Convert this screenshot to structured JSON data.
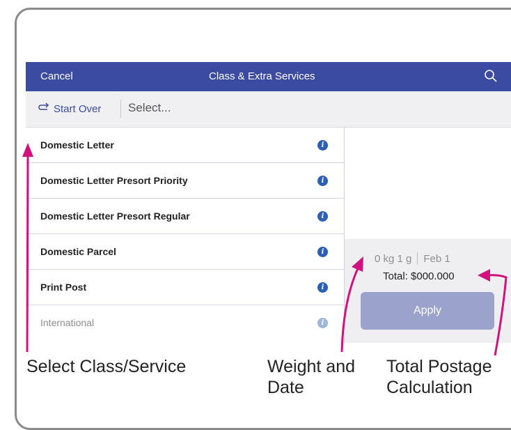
{
  "header": {
    "cancel_label": "Cancel",
    "title": "Class & Extra Services",
    "search_icon": "search-icon"
  },
  "subbar": {
    "start_over_label": "Start Over",
    "start_over_icon": "redo-arrow-icon",
    "select_placeholder": "Select..."
  },
  "services": [
    {
      "label": "Domestic Letter",
      "info_icon": "i"
    },
    {
      "label": "Domestic Letter Presort Priority",
      "info_icon": "i"
    },
    {
      "label": "Domestic Letter Presort Regular",
      "info_icon": "i"
    },
    {
      "label": "Domestic Parcel",
      "info_icon": "i"
    },
    {
      "label": "Print Post",
      "info_icon": "i"
    },
    {
      "label": "International",
      "info_icon": "i",
      "disabled": true
    }
  ],
  "summary": {
    "weight": "0 kg 1 g",
    "date": "Feb 1",
    "total": "Total: $000.000",
    "apply_label": "Apply"
  },
  "captions": {
    "select_class": "Select Class/Service",
    "weight_date_line1": "Weight and",
    "weight_date_line2": "Date",
    "total_postage_line1": "Total Postage",
    "total_postage_line2": "Calculation"
  },
  "colors": {
    "header_bg": "#3b4ba1",
    "apply_bg": "#9ba3cd",
    "annotation_arrow": "#d0127e",
    "info_icon": "#2e5fb7"
  }
}
